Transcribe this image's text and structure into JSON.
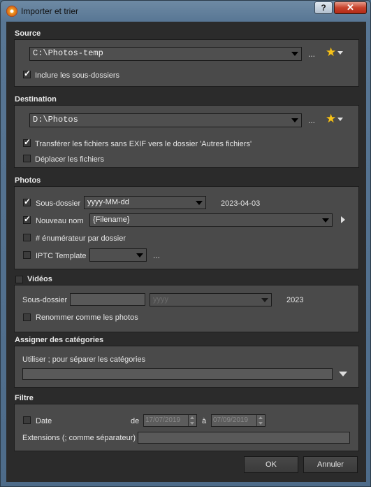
{
  "window": {
    "title": "Importer et trier",
    "help_label": "?",
    "close_label": "✕"
  },
  "source": {
    "title": "Source",
    "folder": "C:\\Photos-temp",
    "ellipsis": "...",
    "include_subfolders_label": "Inclure les sous-dossiers",
    "include_subfolders_checked": true
  },
  "destination": {
    "title": "Destination",
    "folder": "D:\\Photos",
    "ellipsis": "...",
    "transfer_no_exif_label": "Transférer les fichiers sans EXIF vers le dossier 'Autres fichiers'",
    "transfer_no_exif_checked": true,
    "move_files_label": "Déplacer les fichiers",
    "move_files_checked": false
  },
  "photos": {
    "title": "Photos",
    "subfolder_label": "Sous-dossier",
    "subfolder_checked": true,
    "subfolder_format": "yyyy-MM-dd",
    "subfolder_preview": "2023-04-03",
    "rename_label": "Nouveau nom",
    "rename_checked": true,
    "rename_pattern": "{Filename}",
    "enumerator_label": "# énumérateur par dossier",
    "enumerator_checked": false,
    "iptc_label": "IPTC Template",
    "iptc_checked": false,
    "iptc_value": "",
    "iptc_ellipsis": "..."
  },
  "videos": {
    "title": "Vidéos",
    "checked": false,
    "subfolder_label": "Sous-dossier",
    "subfolder_value": "",
    "format_value": "yyyy",
    "preview": "2023",
    "rename_like_photos_label": "Renommer comme les photos",
    "rename_like_photos_checked": false
  },
  "categories": {
    "title": "Assigner des catégories",
    "hint": "Utiliser ; pour séparer les catégories",
    "value": ""
  },
  "filter": {
    "title": "Filtre",
    "date_label": "Date",
    "date_checked": false,
    "from_label": "de",
    "from_value": "17/07/2019",
    "to_label": "à",
    "to_value": "07/09/2019",
    "extensions_label": "Extensions (; comme séparateur)",
    "extensions_value": ""
  },
  "buttons": {
    "ok_label": "OK",
    "cancel_label": "Annuler"
  },
  "colors": {
    "title_bar": "#587694",
    "panel": "#4a4a4a",
    "background": "#2b2b2b",
    "star": "#f7c21a"
  }
}
